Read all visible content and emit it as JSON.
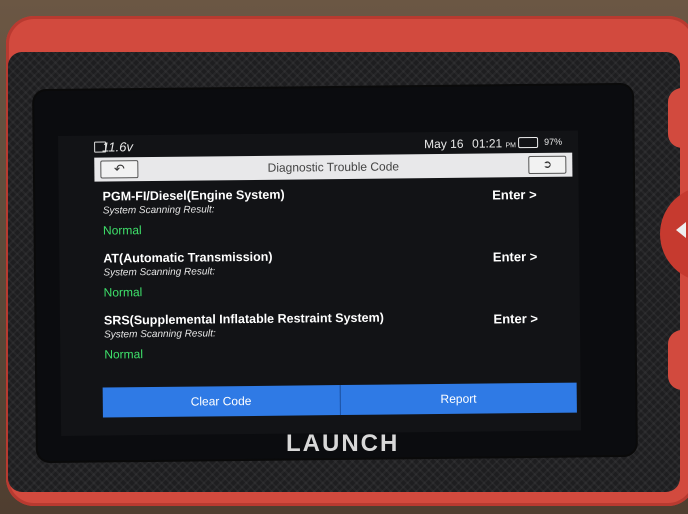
{
  "status": {
    "voltage": "11.6v",
    "date": "May 16",
    "time": "01:21",
    "time_suffix": "PM",
    "battery_pct": "97%"
  },
  "header": {
    "title": "Diagnostic Trouble Code",
    "back_icon": "back-arrow-icon",
    "exit_icon": "exit-icon"
  },
  "systems": [
    {
      "name": "PGM-FI/Diesel(Engine System)",
      "label": "System Scanning Result:",
      "result": "Normal",
      "action": "Enter >"
    },
    {
      "name": "AT(Automatic Transmission)",
      "label": "System Scanning Result:",
      "result": "Normal",
      "action": "Enter >"
    },
    {
      "name": "SRS(Supplemental Inflatable Restraint System)",
      "label": "System Scanning Result:",
      "result": "Normal",
      "action": "Enter >"
    }
  ],
  "footer": {
    "clear_code": "Clear Code",
    "report": "Report"
  },
  "brand": {
    "logo": "LAUNCH"
  },
  "colors": {
    "result_normal": "#3ee06a",
    "button_blue": "#2f7ae5",
    "shell_red": "#d24a3e"
  }
}
